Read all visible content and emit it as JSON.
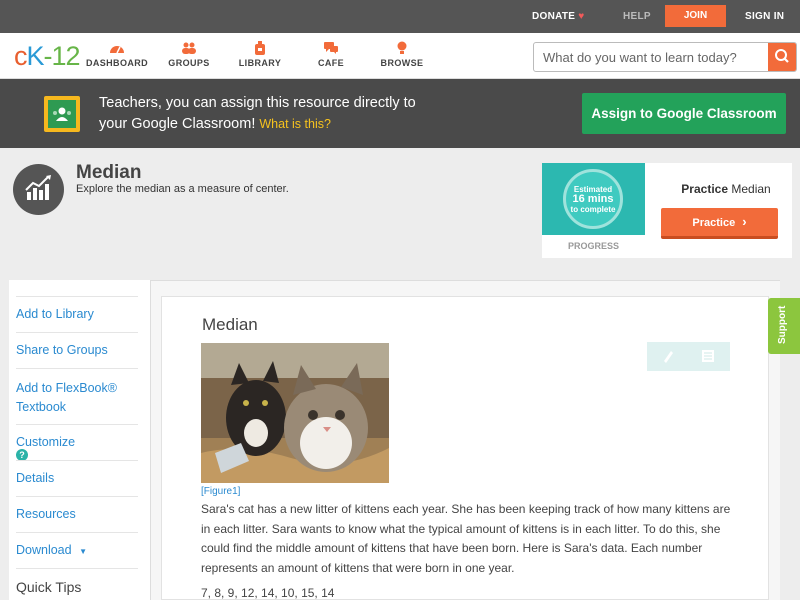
{
  "topbar": {
    "donate": "DONATE",
    "help": "HELP",
    "join": "JOIN",
    "signin": "SIGN IN"
  },
  "logo": {
    "c": "c",
    "k": "K",
    "rest": "-12"
  },
  "nav": [
    {
      "label": "DASHBOARD",
      "icon": "dashboard-icon"
    },
    {
      "label": "GROUPS",
      "icon": "groups-icon"
    },
    {
      "label": "LIBRARY",
      "icon": "library-icon"
    },
    {
      "label": "CAFE",
      "icon": "cafe-icon"
    },
    {
      "label": "BROWSE",
      "icon": "browse-icon"
    }
  ],
  "search": {
    "placeholder": "What do you want to learn today?"
  },
  "classroom": {
    "line1": "Teachers, you can assign this resource directly to",
    "line2": "your Google Classroom!",
    "what": "What is this?",
    "button": "Assign to Google Classroom"
  },
  "header": {
    "title": "Median",
    "subtitle": "Explore the median as a measure of center."
  },
  "practice": {
    "estimated": "Estimated",
    "mins": "16 mins",
    "complete": "to complete",
    "progress_label": "PROGRESS",
    "title_bold": "Practice",
    "title_rest": "Median",
    "button": "Practice"
  },
  "sidebar": {
    "add_library": "Add to Library",
    "share_groups": "Share to Groups",
    "flexbook_1": "Add to FlexBook®",
    "flexbook_2": "Textbook",
    "customize": "Customize",
    "customize_help": "?",
    "details": "Details",
    "resources": "Resources",
    "download": "Download",
    "download_caret": "▼",
    "quick_tips": "Quick Tips"
  },
  "content": {
    "title": "Median",
    "figure_label": "[Figure1]",
    "body": "Sara's cat has a new litter of kittens each year. She has been keeping track of how many kittens are in each litter. Sara wants to know what the typical amount of kittens is in each litter. To do this, she could find the middle amount of kittens that have been born. Here is Sara's data. Each number represents an amount of kittens that were born in one year.",
    "data": "7, 8, 9, 12, 14, 10, 15, 14"
  },
  "support": "Support",
  "colors": {
    "accent": "#f26b3a",
    "link": "#2a8ad0",
    "green": "#23a25a",
    "dark": "#4a4a4a"
  }
}
